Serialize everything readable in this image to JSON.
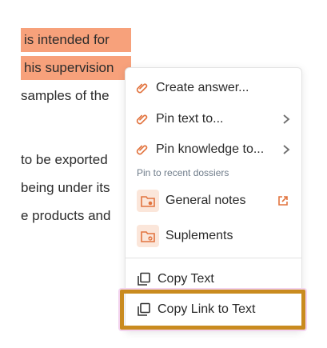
{
  "document": {
    "lines": [
      "is intended for",
      "his supervision",
      "samples of the",
      "to be exported",
      "being under its",
      "e products and"
    ]
  },
  "menu": {
    "items": {
      "create_answer": "Create answer...",
      "pin_text": "Pin text to...",
      "pin_knowledge": "Pin knowledge to...",
      "section_label": "Pin to recent dossiers",
      "general_notes": "General notes",
      "suplements": "Suplements",
      "copy_text": "Copy Text",
      "copy_link": "Copy Link to Text"
    }
  },
  "icons": {
    "clip": "paperclip-icon",
    "folder": "folder-icon",
    "external": "external-link-icon",
    "copy": "copy-icon",
    "chevron": "chevron-right-icon"
  },
  "colors": {
    "highlight": "#f7a17b",
    "accent": "#e2743f",
    "focus_border": "#c98b1f"
  }
}
